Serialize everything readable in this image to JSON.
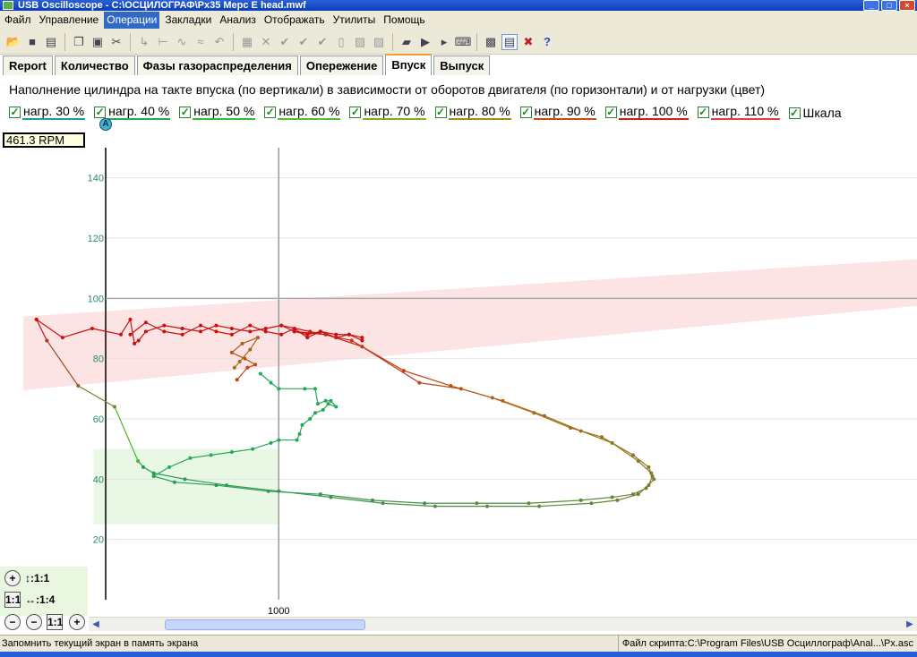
{
  "window": {
    "title": "USB Oscilloscope - C:\\ОСЦИЛОГРАФ\\Px35 Мерс E head.mwf"
  },
  "menu": [
    "Файл",
    "Управление",
    "Операции",
    "Закладки",
    "Анализ",
    "Отображать",
    "Утилиты",
    "Помощь"
  ],
  "menu_active": "Операции",
  "toolbar_icons": [
    "open-icon",
    "save-icon",
    "print-icon",
    "copy-icon",
    "paste-icon",
    "cut-icon",
    "cursor-icon",
    "measure-icon",
    "filter-icon",
    "wave-icon",
    "undo-icon",
    "grid-icon",
    "close-icon",
    "check-icon",
    "check-down-icon",
    "check-left-icon",
    "page-icon",
    "export-icon",
    "import-icon",
    "folder-icon",
    "abc-run-icon",
    "abc-step-icon",
    "keyboard-icon",
    "chart-icon",
    "notes-icon",
    "delete-icon",
    "help-icon"
  ],
  "tabs": [
    "Report",
    "Количество",
    "Фазы газораспределения",
    "Опережение",
    "Впуск",
    "Выпуск"
  ],
  "active_tab": "Впуск",
  "heading": "Наполнение цилиндра на такте впуска (по вертикали) в зависимости от оборотов двигателя (по горизонтали) и от нагрузки (цвет)",
  "legend": [
    {
      "label": "нагр. 30 %",
      "color": "#1a9fa0"
    },
    {
      "label": "нагр. 40 %",
      "color": "#22aa55"
    },
    {
      "label": "нагр. 50 %",
      "color": "#35bb35"
    },
    {
      "label": "нагр. 60 %",
      "color": "#50c030"
    },
    {
      "label": "нагр. 70 %",
      "color": "#80b020"
    },
    {
      "label": "нагр. 80 %",
      "color": "#a09018"
    },
    {
      "label": "нагр. 90 %",
      "color": "#c05010"
    },
    {
      "label": "нагр. 100 %",
      "color": "#d02010"
    },
    {
      "label": "нагр. 110 %",
      "color": "#e04040"
    },
    {
      "label": "Шкала",
      "color": "#ffffff"
    }
  ],
  "rpm_readout": "461.3 RPM",
  "cursor_label": "A",
  "zoom": {
    "vertical": "↕:1:1",
    "horizontal": "↔:1:4",
    "reset": "1:1"
  },
  "status": {
    "left": "Запомнить текущий экран в память экрана",
    "right": "Файл скрипта:C:\\Program Files\\USB Осциллограф\\Anal...\\Px.asc"
  },
  "chart_data": {
    "type": "line",
    "title": "Наполнение цилиндра на такте впуска (по вертикали) в зависимости от оборотов двигателя (по горизонтали) и от нагрузки (цвет)",
    "xlabel": "",
    "ylabel": "",
    "xlim": [
      465,
      2225
    ],
    "ylim": [
      0,
      150
    ],
    "y_ticks": [
      20,
      40,
      60,
      80,
      100,
      120,
      140
    ],
    "x_ticks": [
      1000
    ],
    "cursor": {
      "x": 1000,
      "y": 100
    },
    "bands": [
      {
        "name": "red-zone",
        "color": "#fde4e4",
        "polygon": [
          [
            510,
            69.5
          ],
          [
            510,
            94
          ],
          [
            2225,
            113
          ],
          [
            2225,
            97.5
          ]
        ]
      },
      {
        "name": "green-zone",
        "color": "#e9f8e4",
        "polygon": [
          [
            645,
            25
          ],
          [
            645,
            50
          ],
          [
            1000,
            50
          ],
          [
            1000,
            25
          ]
        ]
      }
    ],
    "series": [
      {
        "color_from": "#cc1010",
        "color_to": "#cc1010",
        "points": [
          [
            535,
            93
          ],
          [
            585,
            87
          ],
          [
            642,
            90
          ],
          [
            697,
            88
          ],
          [
            715,
            93
          ],
          [
            723,
            85
          ],
          [
            731,
            86
          ],
          [
            745,
            89
          ],
          [
            780,
            91
          ],
          [
            815,
            90
          ],
          [
            850,
            89
          ],
          [
            880,
            91
          ],
          [
            910,
            90
          ],
          [
            945,
            89
          ],
          [
            975,
            90
          ],
          [
            1005,
            91
          ],
          [
            1030,
            89
          ],
          [
            1055,
            88
          ],
          [
            1080,
            89
          ],
          [
            1110,
            88
          ],
          [
            1135,
            88
          ],
          [
            1160,
            87
          ]
        ]
      },
      {
        "color_from": "#cc1010",
        "color_to": "#cc1010",
        "points": [
          [
            715,
            88
          ],
          [
            745,
            92
          ],
          [
            780,
            89
          ],
          [
            815,
            88
          ],
          [
            850,
            91
          ],
          [
            880,
            89
          ],
          [
            910,
            88
          ],
          [
            945,
            91
          ],
          [
            975,
            89
          ],
          [
            1005,
            88
          ],
          [
            1030,
            90
          ],
          [
            1055,
            87
          ],
          [
            1080,
            89
          ],
          [
            1110,
            87
          ],
          [
            1135,
            88
          ],
          [
            1160,
            86
          ]
        ]
      },
      {
        "color_from": "#cc1010",
        "color_to": "#b07018",
        "points": [
          [
            1005,
            91
          ],
          [
            1060,
            89
          ],
          [
            1140,
            86
          ],
          [
            1240,
            76
          ],
          [
            1330,
            71
          ],
          [
            1410,
            67
          ],
          [
            1490,
            62
          ]
        ]
      },
      {
        "color_from": "#cc1010",
        "color_to": "#b07018",
        "points": [
          [
            1030,
            89
          ],
          [
            1090,
            88
          ],
          [
            1160,
            84
          ],
          [
            1270,
            72
          ],
          [
            1350,
            70
          ],
          [
            1430,
            66
          ],
          [
            1510,
            61
          ]
        ]
      },
      {
        "color_from": "#a07018",
        "color_to": "#1aa060",
        "points": [
          [
            1490,
            62
          ],
          [
            1560,
            57
          ],
          [
            1620,
            54
          ],
          [
            1680,
            48
          ],
          [
            1710,
            44
          ],
          [
            1717,
            41
          ],
          [
            1710,
            38
          ],
          [
            1690,
            35
          ],
          [
            1650,
            33
          ],
          [
            1600,
            32
          ],
          [
            1500,
            31
          ],
          [
            1400,
            31
          ],
          [
            1300,
            31
          ],
          [
            1200,
            32
          ],
          [
            1100,
            34
          ],
          [
            1000,
            36
          ],
          [
            900,
            38
          ],
          [
            820,
            40
          ],
          [
            760,
            42
          ],
          [
            740,
            44
          ],
          [
            730,
            46
          ]
        ]
      },
      {
        "color_from": "#a07018",
        "color_to": "#1aa060",
        "points": [
          [
            1510,
            61
          ],
          [
            1580,
            56
          ],
          [
            1640,
            52
          ],
          [
            1690,
            46
          ],
          [
            1715,
            42
          ],
          [
            1720,
            40
          ],
          [
            1705,
            37
          ],
          [
            1680,
            35
          ],
          [
            1640,
            34
          ],
          [
            1580,
            33
          ],
          [
            1480,
            32
          ],
          [
            1380,
            32
          ],
          [
            1280,
            32
          ],
          [
            1180,
            33
          ],
          [
            1080,
            35
          ],
          [
            980,
            36
          ],
          [
            880,
            38
          ],
          [
            800,
            39
          ],
          [
            760,
            41
          ]
        ]
      },
      {
        "color_from": "#22aa55",
        "color_to": "#22aa55",
        "points": [
          [
            760,
            41
          ],
          [
            790,
            44
          ],
          [
            830,
            47
          ],
          [
            870,
            48
          ],
          [
            910,
            49
          ],
          [
            950,
            50
          ],
          [
            985,
            52
          ],
          [
            1000,
            53
          ],
          [
            1035,
            53
          ],
          [
            1040,
            55
          ],
          [
            1045,
            58
          ],
          [
            1060,
            60
          ],
          [
            1070,
            62
          ],
          [
            1085,
            63
          ],
          [
            1095,
            65
          ],
          [
            1110,
            64
          ],
          [
            1100,
            66
          ],
          [
            1090,
            66
          ],
          [
            1075,
            65
          ],
          [
            1070,
            70
          ],
          [
            1050,
            70
          ],
          [
            1000,
            70
          ],
          [
            985,
            72
          ],
          [
            965,
            75
          ]
        ]
      },
      {
        "color_from": "#c04010",
        "color_to": "#a07018",
        "points": [
          [
            920,
            73
          ],
          [
            940,
            77
          ],
          [
            955,
            78
          ],
          [
            935,
            80
          ],
          [
            910,
            82
          ],
          [
            930,
            85
          ],
          [
            960,
            87
          ],
          [
            945,
            83
          ],
          [
            925,
            79
          ],
          [
            915,
            77
          ]
        ]
      },
      {
        "color_from": "#cc1010",
        "color_to": "#4db82e",
        "points": [
          [
            535,
            93
          ],
          [
            555,
            86
          ],
          [
            615,
            71
          ],
          [
            685,
            64
          ],
          [
            730,
            46
          ]
        ]
      }
    ]
  }
}
